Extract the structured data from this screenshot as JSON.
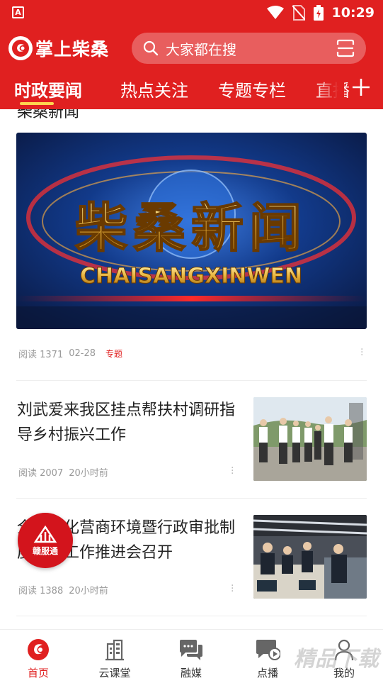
{
  "status": {
    "time": "10:29",
    "app_badge": "A"
  },
  "header": {
    "app_name": "掌上柴桑",
    "search_placeholder": "大家都在搜"
  },
  "tabs": [
    {
      "label": "时政要闻",
      "active": true
    },
    {
      "label": "热点关注"
    },
    {
      "label": "专题专栏"
    },
    {
      "label": "直播"
    }
  ],
  "feed": {
    "partial_title": "柴桑新闻",
    "hero": {
      "title_cn": "柴桑新闻",
      "title_en": "CHAISANGXINWEN",
      "read_label": "阅读 1371",
      "date": "02-28",
      "tag": "专题"
    },
    "items": [
      {
        "title": "刘武爱来我区挂点帮扶村调研指导乡村振兴工作",
        "read_label": "阅读 2007",
        "time": "20小时前"
      },
      {
        "title": "全区优化营商环境暨行政审批制度改革工作推进会召开",
        "read_label": "阅读 1388",
        "time": "20小时前"
      }
    ]
  },
  "float_badge": {
    "label": "赣服通"
  },
  "bottom_nav": [
    {
      "label": "首页",
      "icon": "home-logo-icon",
      "active": true
    },
    {
      "label": "云课堂",
      "icon": "building-icon"
    },
    {
      "label": "融媒",
      "icon": "chat-bubbles-icon"
    },
    {
      "label": "点播",
      "icon": "video-chat-icon"
    },
    {
      "label": "我的",
      "icon": "user-icon"
    }
  ],
  "watermark": "精品下载",
  "colors": {
    "brand_red": "#e02020",
    "tab_underline": "#ffd54f",
    "tag_red": "#e02020"
  }
}
